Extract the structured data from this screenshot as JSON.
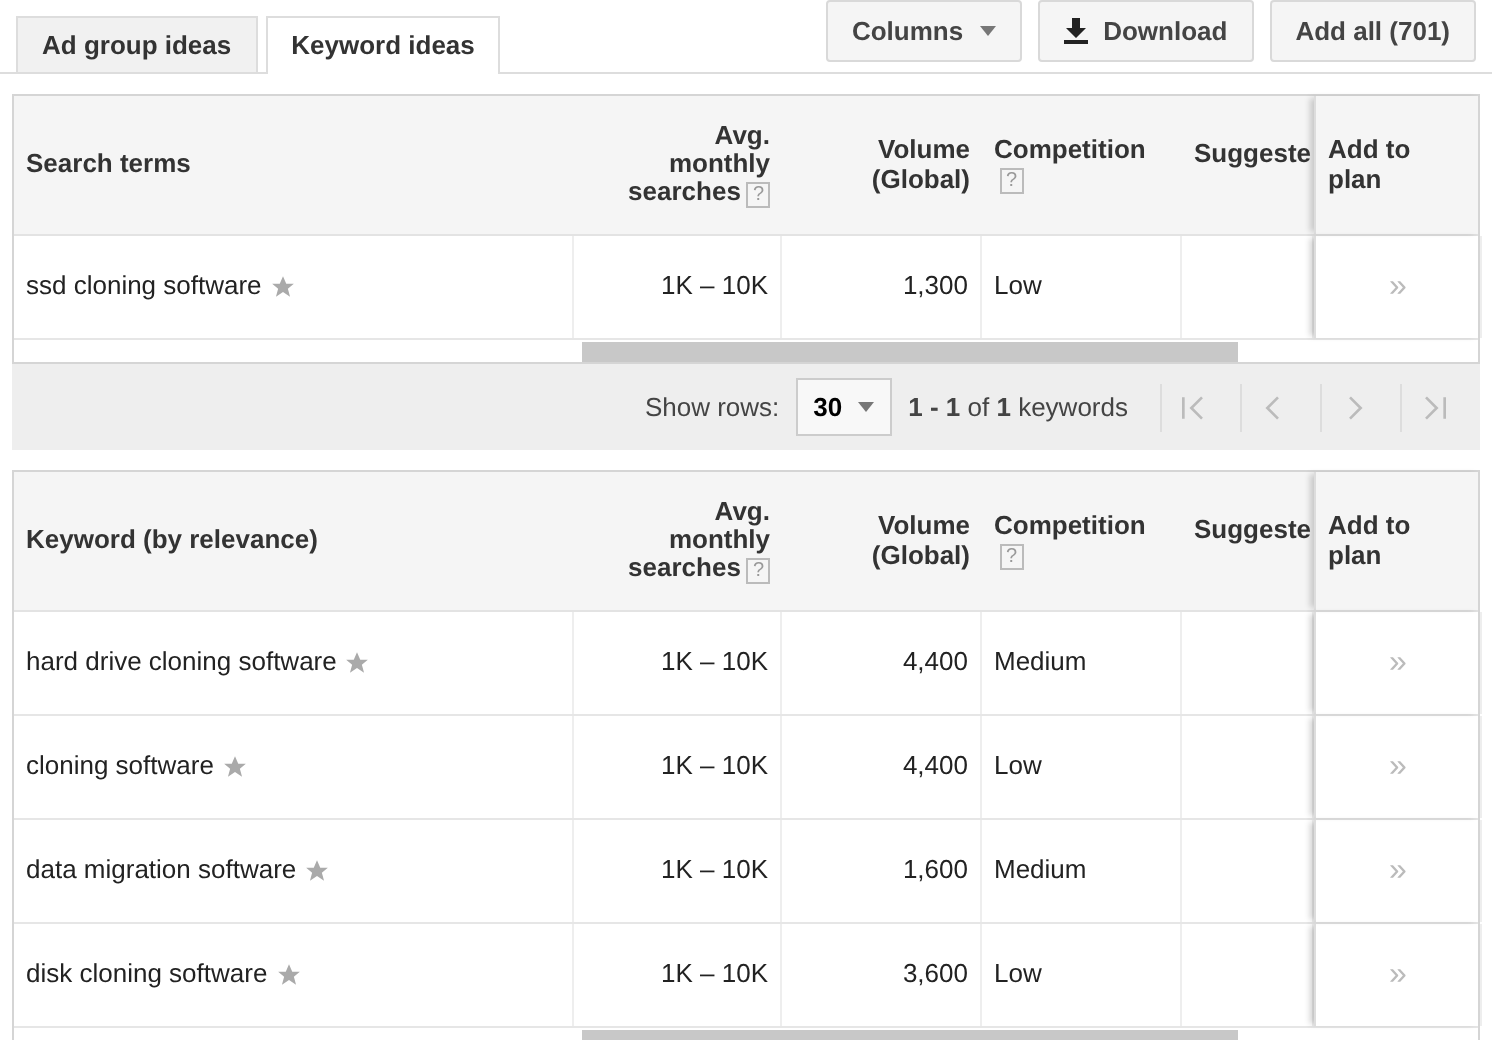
{
  "tabs": [
    {
      "label": "Ad group ideas",
      "selected": false
    },
    {
      "label": "Keyword ideas",
      "selected": true
    }
  ],
  "toolbar": [
    {
      "label": "Columns",
      "kind": "dropdown"
    },
    {
      "label": "Download",
      "kind": "download"
    },
    {
      "label": "Add all (701)",
      "kind": "plain"
    }
  ],
  "tables": [
    {
      "columns": [
        {
          "label": "Search terms"
        },
        {
          "label": "Avg. monthly searches",
          "help": "?"
        },
        {
          "label": "Volume (Global)"
        },
        {
          "label": "Competition",
          "help": "?"
        },
        {
          "label": "Suggeste"
        },
        {
          "label": "Add to plan"
        }
      ],
      "rows": [
        {
          "keyword": "ssd cloning software",
          "searches": "1K – 10K",
          "volume": "1,300",
          "competition": "Low",
          "add": "»"
        }
      ],
      "pagination": {
        "label": "Show rows:",
        "value": "30",
        "range": "**1 - 1** of **1** keywords"
      }
    },
    {
      "columns": [
        {
          "label": "Keyword (by relevance)"
        },
        {
          "label": "Avg. monthly searches",
          "help": "?"
        },
        {
          "label": "Volume (Global)"
        },
        {
          "label": "Competition",
          "help": "?"
        },
        {
          "label": "Suggeste"
        },
        {
          "label": "Add to plan"
        }
      ],
      "rows": [
        {
          "keyword": "hard drive cloning software",
          "searches": "1K – 10K",
          "volume": "4,400",
          "competition": "Medium",
          "add": "»"
        },
        {
          "keyword": "cloning software",
          "searches": "1K – 10K",
          "volume": "4,400",
          "competition": "Low",
          "add": "»"
        },
        {
          "keyword": "data migration software",
          "searches": "1K – 10K",
          "volume": "1,600",
          "competition": "Medium",
          "add": "»"
        },
        {
          "keyword": "disk cloning software",
          "searches": "1K – 10K",
          "volume": "3,600",
          "competition": "Low",
          "add": "»"
        }
      ]
    }
  ]
}
